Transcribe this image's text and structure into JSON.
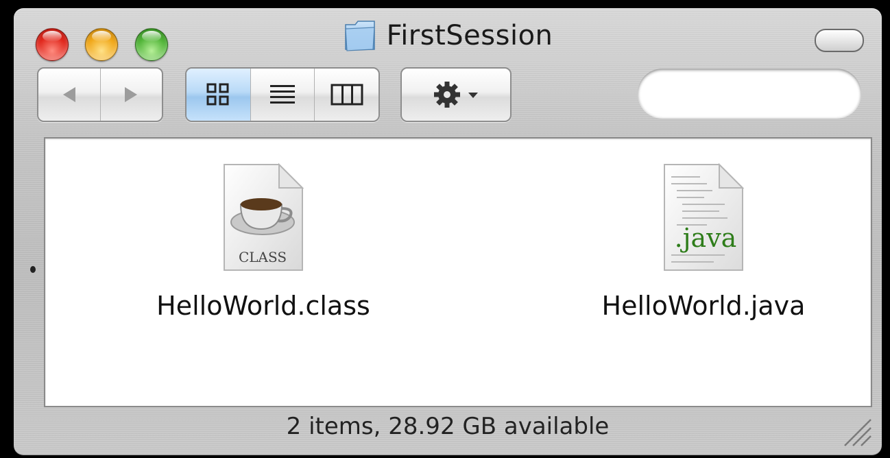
{
  "window": {
    "title": "FirstSession",
    "title_icon": "folder-icon"
  },
  "toolbar": {
    "back_icon": "back-arrow-icon",
    "forward_icon": "forward-arrow-icon",
    "view_modes": [
      "icon-view-icon",
      "list-view-icon",
      "column-view-icon"
    ],
    "active_view": "icon-view-icon",
    "action_icon": "gear-icon",
    "search": {
      "value": "",
      "placeholder": "",
      "icon": "search-icon"
    }
  },
  "files": [
    {
      "name": "HelloWorld.class",
      "icon": "java-class-file-icon",
      "badge": "CLASS"
    },
    {
      "name": "HelloWorld.java",
      "icon": "java-source-file-icon",
      "badge": ".java"
    }
  ],
  "status_bar": {
    "text": "2 items, 28.92 GB available"
  },
  "colors": {
    "selected_segment": "#9cc7ee",
    "java_green": "#2e7d1a"
  }
}
